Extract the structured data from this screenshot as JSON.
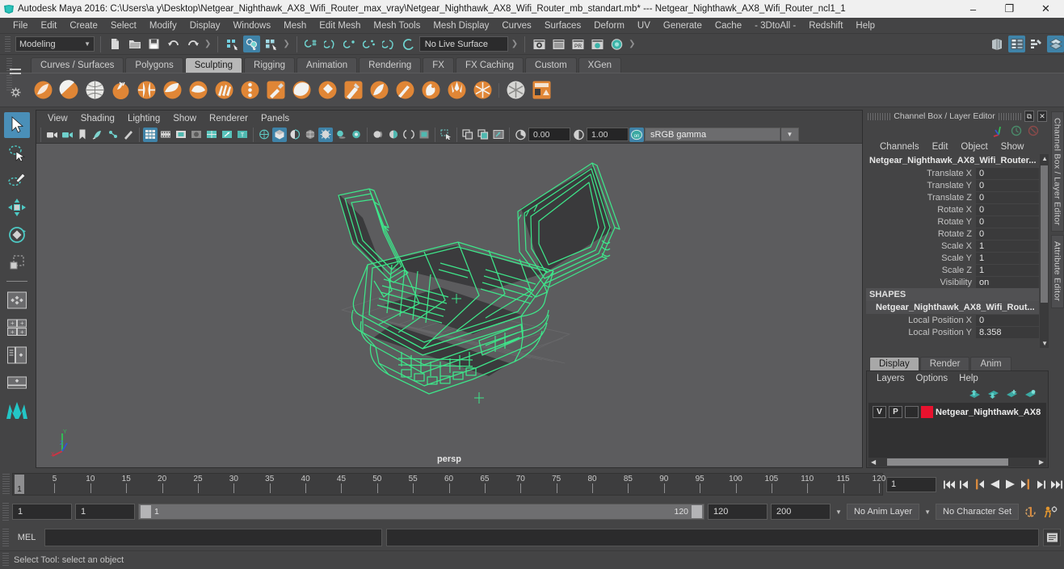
{
  "window": {
    "app_title": "Autodesk Maya 2016: C:\\Users\\a y\\Desktop\\Netgear_Nighthawk_AX8_Wifi_Router_max_vray\\Netgear_Nighthawk_AX8_Wifi_Router_mb_standart.mb*  ---  Netgear_Nighthawk_AX8_Wifi_Router_ncl1_1",
    "minimize": "–",
    "maximize": "❐",
    "close": "✕"
  },
  "menubar": {
    "items": [
      {
        "label": "File"
      },
      {
        "label": "Edit"
      },
      {
        "label": "Create"
      },
      {
        "label": "Select"
      },
      {
        "label": "Modify"
      },
      {
        "label": "Display"
      },
      {
        "label": "Windows"
      },
      {
        "label": "Mesh"
      },
      {
        "label": "Edit Mesh"
      },
      {
        "label": "Mesh Tools"
      },
      {
        "label": "Mesh Display"
      },
      {
        "label": "Curves"
      },
      {
        "label": "Surfaces"
      },
      {
        "label": "Deform"
      },
      {
        "label": "UV"
      },
      {
        "label": "Generate"
      },
      {
        "label": "Cache"
      },
      {
        "label": "- 3DtoAll -"
      },
      {
        "label": "Redshift"
      },
      {
        "label": "Help"
      }
    ]
  },
  "statusbar": {
    "menuset": "Modeling",
    "menuset_arrow": "▼",
    "live_surface": "No Live Surface",
    "chevron": "❯"
  },
  "shelf": {
    "tabs": [
      {
        "label": "Curves / Surfaces",
        "active": false
      },
      {
        "label": "Polygons",
        "active": false
      },
      {
        "label": "Sculpting",
        "active": true
      },
      {
        "label": "Rigging",
        "active": false
      },
      {
        "label": "Animation",
        "active": false
      },
      {
        "label": "Rendering",
        "active": false
      },
      {
        "label": "FX",
        "active": false
      },
      {
        "label": "FX Caching",
        "active": false
      },
      {
        "label": "Custom",
        "active": false
      },
      {
        "label": "XGen",
        "active": false
      }
    ],
    "icons": [
      "sculpt-brush-icon",
      "smooth-brush-icon",
      "relax-brush-icon",
      "grab-brush-icon",
      "pinch-brush-icon",
      "flatten-brush-icon",
      "foamy-brush-icon",
      "spray-brush-icon",
      "repeat-brush-icon",
      "imprint-brush-icon",
      "wax-brush-icon",
      "scrape-brush-icon",
      "fill-brush-icon",
      "knife-brush-icon",
      "smear-brush-icon",
      "bulge-brush-icon",
      "amplify-brush-icon",
      "freeze-brush-icon",
      "unfreeze-brush-icon",
      "convert-texture-icon"
    ]
  },
  "toolbox": {
    "tools": [
      {
        "name": "select-tool",
        "selected": true
      },
      {
        "name": "lasso-select-tool",
        "selected": false
      },
      {
        "name": "paint-select-tool",
        "selected": false
      },
      {
        "name": "move-tool",
        "selected": false
      },
      {
        "name": "rotate-tool",
        "selected": false
      },
      {
        "name": "scale-tool",
        "selected": false
      }
    ],
    "layouts": [
      {
        "name": "single-perspective-layout"
      },
      {
        "name": "four-view-layout"
      },
      {
        "name": "outliner-persp-layout"
      },
      {
        "name": "persp-graph-layout"
      }
    ]
  },
  "viewport": {
    "menus": [
      {
        "label": "View"
      },
      {
        "label": "Shading"
      },
      {
        "label": "Lighting"
      },
      {
        "label": "Show"
      },
      {
        "label": "Renderer"
      },
      {
        "label": "Panels"
      }
    ],
    "exposure_value": "0.00",
    "gamma_value": "1.00",
    "color_space": "sRGB gamma",
    "color_space_arrow": "▼",
    "camera_label": "persp",
    "wireframe_color": "#3ee68a",
    "background_color": "#5c5c5e",
    "axis_labels": {
      "x": "X",
      "y": "Y",
      "z": "Z"
    }
  },
  "channelbox": {
    "panel_title": "Channel Box / Layer Editor",
    "undock_icon": "⧉",
    "close_icon": "✕",
    "menus": [
      {
        "label": "Channels"
      },
      {
        "label": "Edit"
      },
      {
        "label": "Object"
      },
      {
        "label": "Show"
      }
    ],
    "object_name": "Netgear_Nighthawk_AX8_Wifi_Router...",
    "transform_channels": [
      {
        "label": "Translate X",
        "value": "0"
      },
      {
        "label": "Translate Y",
        "value": "0"
      },
      {
        "label": "Translate Z",
        "value": "0"
      },
      {
        "label": "Rotate X",
        "value": "0"
      },
      {
        "label": "Rotate Y",
        "value": "0"
      },
      {
        "label": "Rotate Z",
        "value": "0"
      },
      {
        "label": "Scale X",
        "value": "1"
      },
      {
        "label": "Scale Y",
        "value": "1"
      },
      {
        "label": "Scale Z",
        "value": "1"
      },
      {
        "label": "Visibility",
        "value": "on"
      }
    ],
    "shapes_header": "SHAPES",
    "shape_name": "Netgear_Nighthawk_AX8_Wifi_Rout...",
    "shape_channels": [
      {
        "label": "Local Position X",
        "value": "0"
      },
      {
        "label": "Local Position Y",
        "value": "8.358"
      }
    ],
    "scroll_up": "▲",
    "scroll_down": "▼"
  },
  "layereditor": {
    "tabs": [
      {
        "label": "Display",
        "active": true
      },
      {
        "label": "Render",
        "active": false
      },
      {
        "label": "Anim",
        "active": false
      }
    ],
    "menus": [
      {
        "label": "Layers"
      },
      {
        "label": "Options"
      },
      {
        "label": "Help"
      }
    ],
    "action_icons": [
      "layer-move-up-icon",
      "layer-move-down-icon",
      "layer-new-icon",
      "layer-new-from-selected-icon"
    ],
    "layers": [
      {
        "visibility": "V",
        "playback": "P",
        "state": "",
        "color": "#e8122e",
        "name": "Netgear_Nighthawk_AX8"
      }
    ],
    "scroll_left": "◀",
    "scroll_right": "▶"
  },
  "sidetabs": [
    {
      "label": "Channel Box / Layer Editor"
    },
    {
      "label": "Attribute Editor"
    }
  ],
  "timeline": {
    "ticks": [
      5,
      10,
      15,
      20,
      25,
      30,
      35,
      40,
      45,
      50,
      55,
      60,
      65,
      70,
      75,
      80,
      85,
      90,
      95,
      100,
      105,
      110,
      115,
      120
    ],
    "range_start": 1,
    "range_end": 120,
    "current_frame": "1",
    "cursor_label": "1",
    "playback_buttons": [
      {
        "name": "go-to-start-button",
        "glyph": "start"
      },
      {
        "name": "step-back-frame-button",
        "glyph": "stepback"
      },
      {
        "name": "step-back-key-button",
        "glyph": "keyback"
      },
      {
        "name": "play-backwards-button",
        "glyph": "playback"
      },
      {
        "name": "play-forwards-button",
        "glyph": "playfwd"
      },
      {
        "name": "step-forward-key-button",
        "glyph": "keyfwd"
      },
      {
        "name": "step-forward-frame-button",
        "glyph": "stepfwd"
      },
      {
        "name": "go-to-end-button",
        "glyph": "end"
      }
    ]
  },
  "rangeslider": {
    "anim_start": "1",
    "range_start": "1",
    "slider_start_label": "1",
    "slider_end_label": "120",
    "range_end": "120",
    "anim_end": "200",
    "anim_layer": "No Anim Layer",
    "character_set": "No Character Set",
    "arrow": "▼"
  },
  "commandline": {
    "language_label": "MEL",
    "input_value": "",
    "output_value": "",
    "script_editor_icon": "script-editor-icon"
  },
  "helpline": {
    "message": "Select Tool: select an object"
  }
}
